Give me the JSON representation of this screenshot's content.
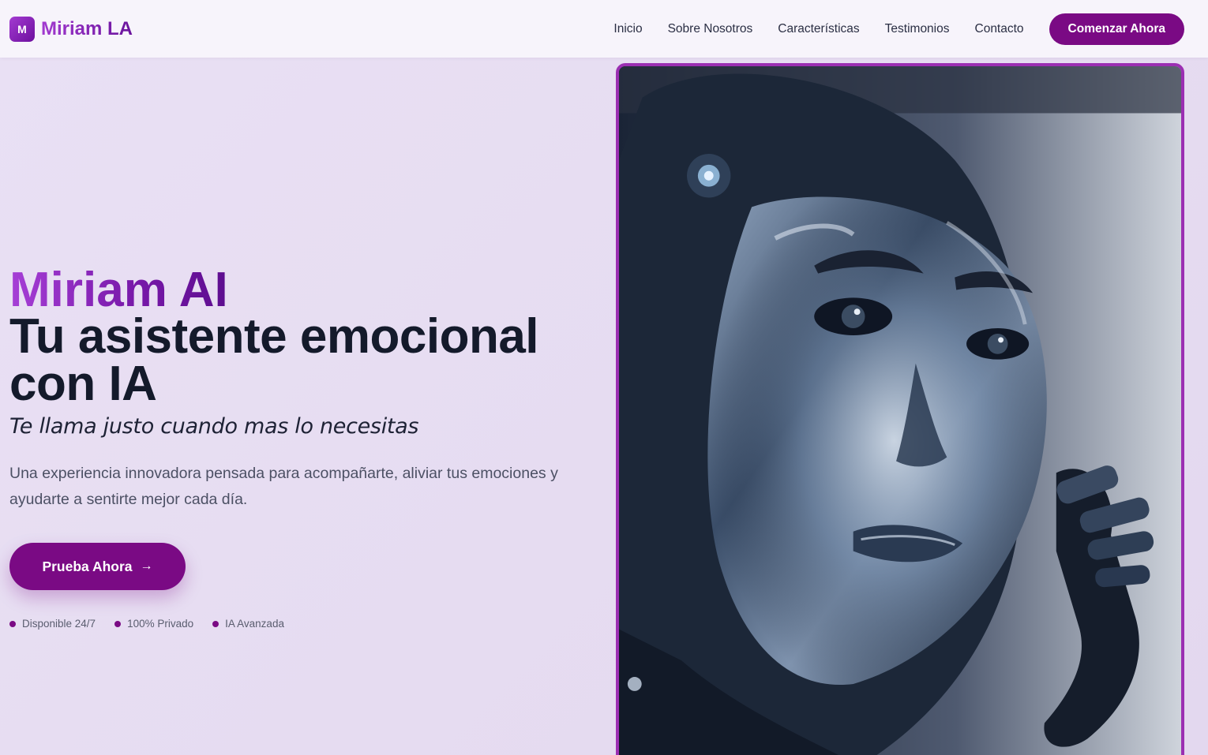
{
  "nav": {
    "logo_letter": "M",
    "brand": "Miriam LA",
    "links": [
      "Inicio",
      "Sobre Nosotros",
      "Características",
      "Testimonios",
      "Contacto"
    ],
    "cta": "Comenzar Ahora"
  },
  "hero": {
    "brand": "Miriam AI",
    "title": "Tu asistente emocional con IA",
    "tagline": "Te llama justo cuando mas lo necesitas",
    "description": "Una experiencia innovadora pensada para acompañarte, aliviar tus emociones y ayudarte a sentirte mejor cada día.",
    "button": "Prueba Ahora",
    "button_icon": "arrow-right-icon",
    "badges": [
      "Disponible 24/7",
      "100% Privado",
      "IA Avanzada"
    ]
  },
  "colors": {
    "accent": "#7a0a84",
    "brand_gradient_start": "#a63fd6",
    "brand_gradient_end": "#5d0d8f",
    "image_border": "#9b2fb2",
    "background": "#e8dff3"
  }
}
